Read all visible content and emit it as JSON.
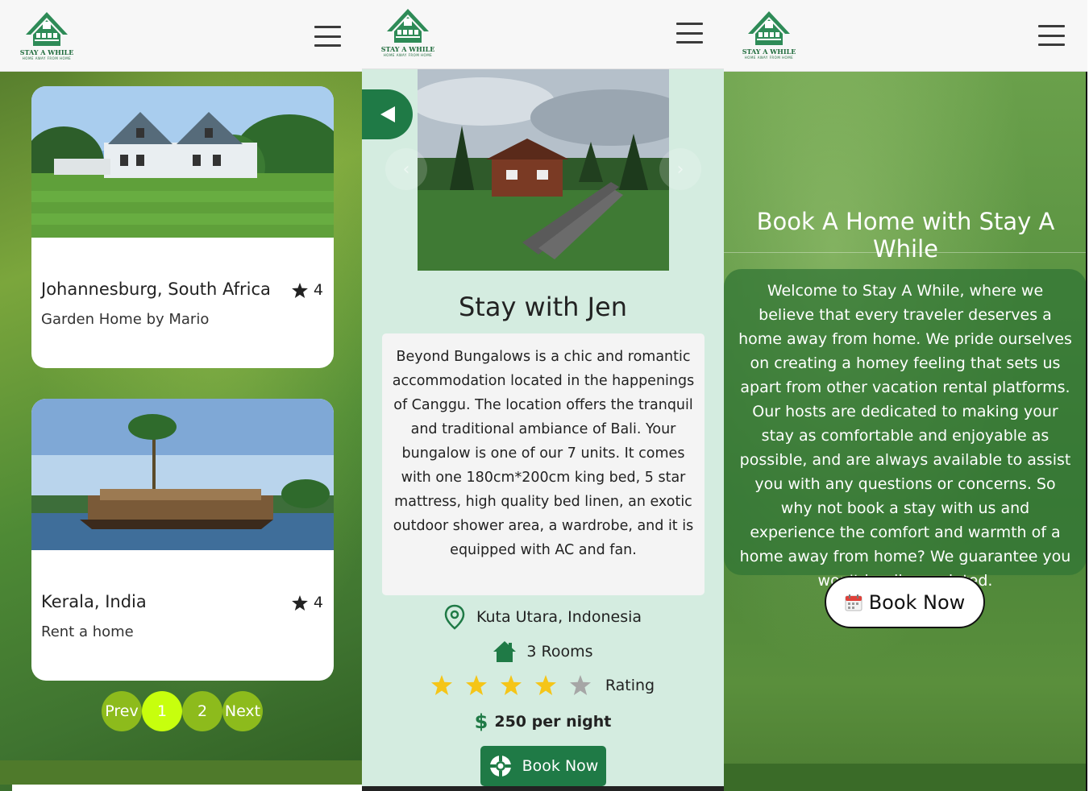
{
  "brand": {
    "name": "STAY A WHILE",
    "tagline": "HOME AWAY FROM HOME",
    "green": "#1f7a46"
  },
  "listings": {
    "cards": [
      {
        "location": "Johannesburg, South Africa",
        "rating": "4",
        "subtitle": "Garden Home by Mario"
      },
      {
        "location": "Kerala, India",
        "rating": "4",
        "subtitle": "Rent a home"
      }
    ],
    "pager": {
      "prev": "Prev",
      "pages": [
        "1",
        "2"
      ],
      "active": "1",
      "next": "Next",
      "active_color": "#c7ff0d"
    }
  },
  "detail": {
    "title": "Stay with Jen",
    "description": "Beyond Bungalows is a chic and romantic accommodation located in the happenings of Canggu. The location offers the tranquil and traditional ambiance of Bali. Your bungalow is one of our 7 units. It comes with one 180cm*200cm king bed, 5 star mattress, high quality bed linen, an exotic outdoor shower area, a wardrobe, and it is equipped with AC and fan.",
    "location": "Kuta Utara, Indonesia",
    "rooms": "3 Rooms",
    "rating_label": "Rating",
    "stars_filled": 4,
    "stars_total": 5,
    "price": "250 per night",
    "book_label": "Book Now",
    "carousel_slides": 5,
    "carousel_active": 1
  },
  "landing": {
    "title": "Book A Home with Stay A While",
    "welcome": "Welcome to Stay A While, where we believe that every traveler deserves a home away from home. We pride ourselves on creating a homey feeling that sets us apart from other vacation rental platforms. Our hosts are dedicated to making your stay as comfortable and enjoyable as possible, and are always available to assist you with any questions or concerns. So why not book a stay with us and experience the comfort and warmth of a home away from home? We guarantee you won't be disappointed.",
    "book_label": "Book Now"
  }
}
